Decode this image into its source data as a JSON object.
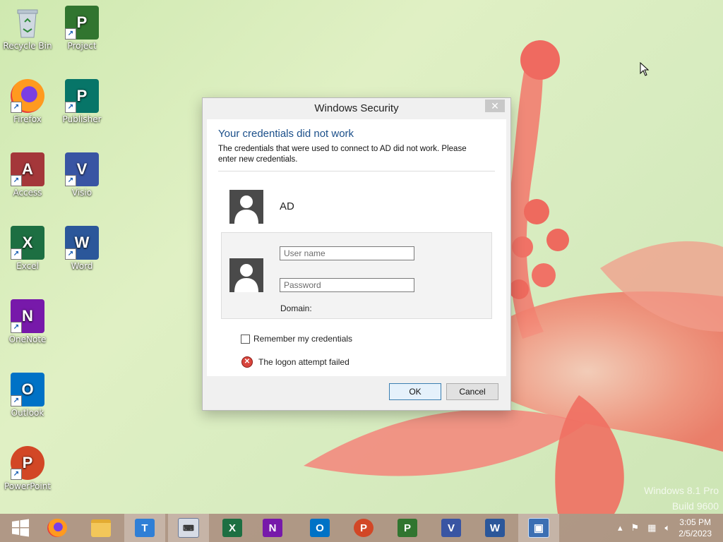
{
  "desktop": {
    "icons": [
      {
        "label": "Recycle Bin"
      },
      {
        "label": "Project"
      },
      {
        "label": "Firefox"
      },
      {
        "label": "Publisher"
      },
      {
        "label": "Access"
      },
      {
        "label": "Visio"
      },
      {
        "label": "Excel"
      },
      {
        "label": "Word"
      },
      {
        "label": "OneNote"
      },
      {
        "label": "Outlook"
      },
      {
        "label": "PowerPoint"
      }
    ],
    "watermark": {
      "line1": "Windows 8.1 Pro",
      "line2": "Build 9600"
    }
  },
  "dialog": {
    "title": "Windows Security",
    "close_glyph": "✕",
    "heading": "Your credentials did not work",
    "message": "The credentials that were used to connect to AD did not work. Please enter new credentials.",
    "account_name": "AD",
    "username_placeholder": "User name",
    "password_placeholder": "Password",
    "domain_label": "Domain:",
    "remember_label": "Remember my credentials",
    "remember_checked": false,
    "error_text": "The logon attempt failed",
    "ok_label": "OK",
    "cancel_label": "Cancel"
  },
  "taskbar": {
    "clock_time": "3:05 PM",
    "clock_date": "2/5/2023"
  },
  "colors": {
    "heading_blue": "#1b4f8a",
    "excel": "#1d6f42",
    "word": "#2b579a",
    "powerpoint": "#d24726",
    "onenote": "#7719aa",
    "outlook": "#0072c6",
    "access": "#a4373a",
    "project": "#31752f",
    "publisher": "#077568",
    "visio": "#3955a3"
  }
}
